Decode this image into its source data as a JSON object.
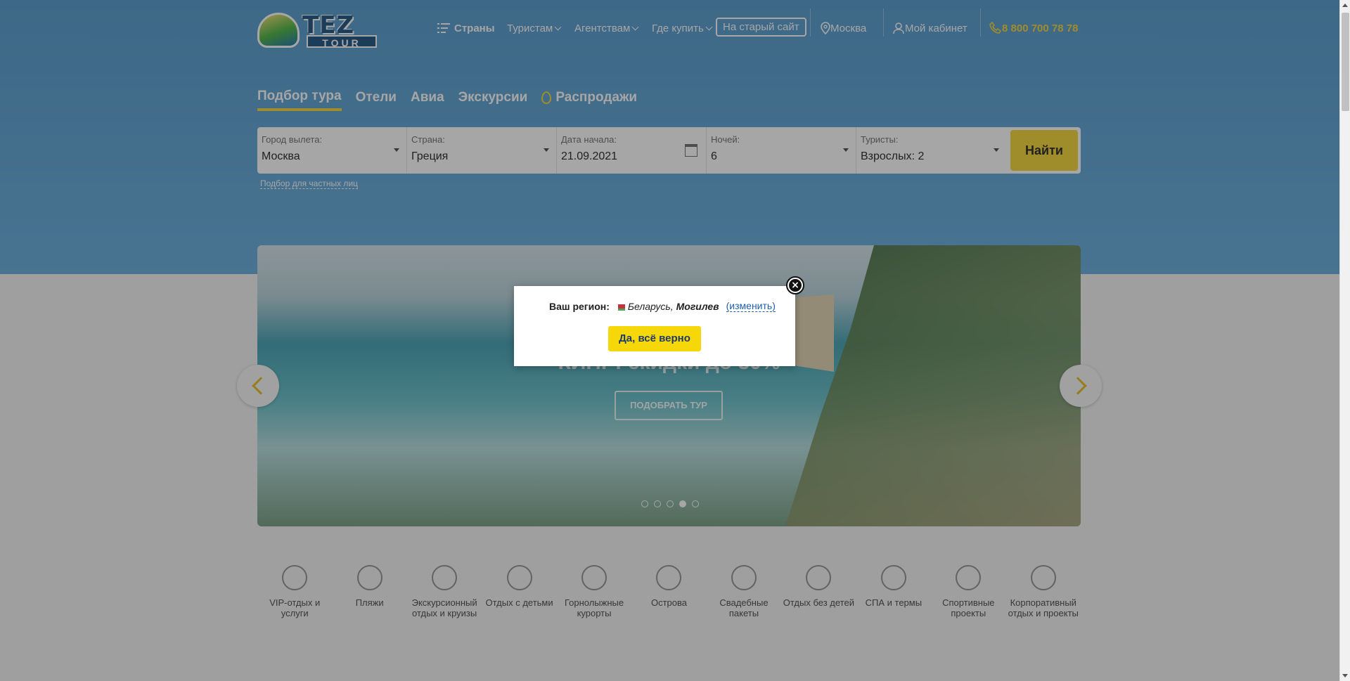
{
  "header": {
    "logo_text_top": "TEZ",
    "logo_text_bottom": "TOUR",
    "nav": {
      "countries": "Страны",
      "tourists": "Туристам",
      "agencies": "Агентствам",
      "where_to_buy": "Где купить",
      "old_site": "На старый сайт",
      "city": "Москва",
      "cabinet": "Мой кабинет",
      "phone": "8 800 700 78 78"
    }
  },
  "tabs": [
    {
      "label": "Подбор тура",
      "active": true
    },
    {
      "label": "Отели"
    },
    {
      "label": "Авиа"
    },
    {
      "label": "Экскурсии"
    },
    {
      "label": "Распродажи"
    }
  ],
  "search": {
    "departure_label": "Город вылета:",
    "departure_value": "Москва",
    "country_label": "Страна:",
    "country_value": "Греция",
    "date_label": "Дата начала:",
    "date_value": "21.09.2021",
    "nights_label": "Ночей:",
    "nights_value": "6",
    "tourists_label": "Туристы:",
    "tourists_value": "Взрослых: 2",
    "find_button": "Найти",
    "private_link": "Подбор для частных лиц"
  },
  "slider": {
    "headline": "КИПР: скидки до 30%",
    "cta": "ПОДОБРАТЬ ТУР",
    "dots": 5,
    "active_dot": 4
  },
  "categories": [
    "VIP-отдых и услуги",
    "Пляжи",
    "Экскурсионный отдых и круизы",
    "Отдых с детьми",
    "Горнолыжные курорты",
    "Острова",
    "Свадебные пакеты",
    "Отдых без детей",
    "СПА и термы",
    "Спортивные проекты",
    "Корпоративный отдых и проекты"
  ],
  "modal": {
    "region_label": "Ваш регион:",
    "country": "Беларусь,",
    "city": "Могилев",
    "change_link": "(изменить)",
    "confirm_button": "Да, всё верно",
    "close_symbol": "×"
  },
  "colors": {
    "accent_yellow": "#f5d743",
    "hero_blue": "#6fb1df",
    "link_blue": "#1f5fa8"
  }
}
